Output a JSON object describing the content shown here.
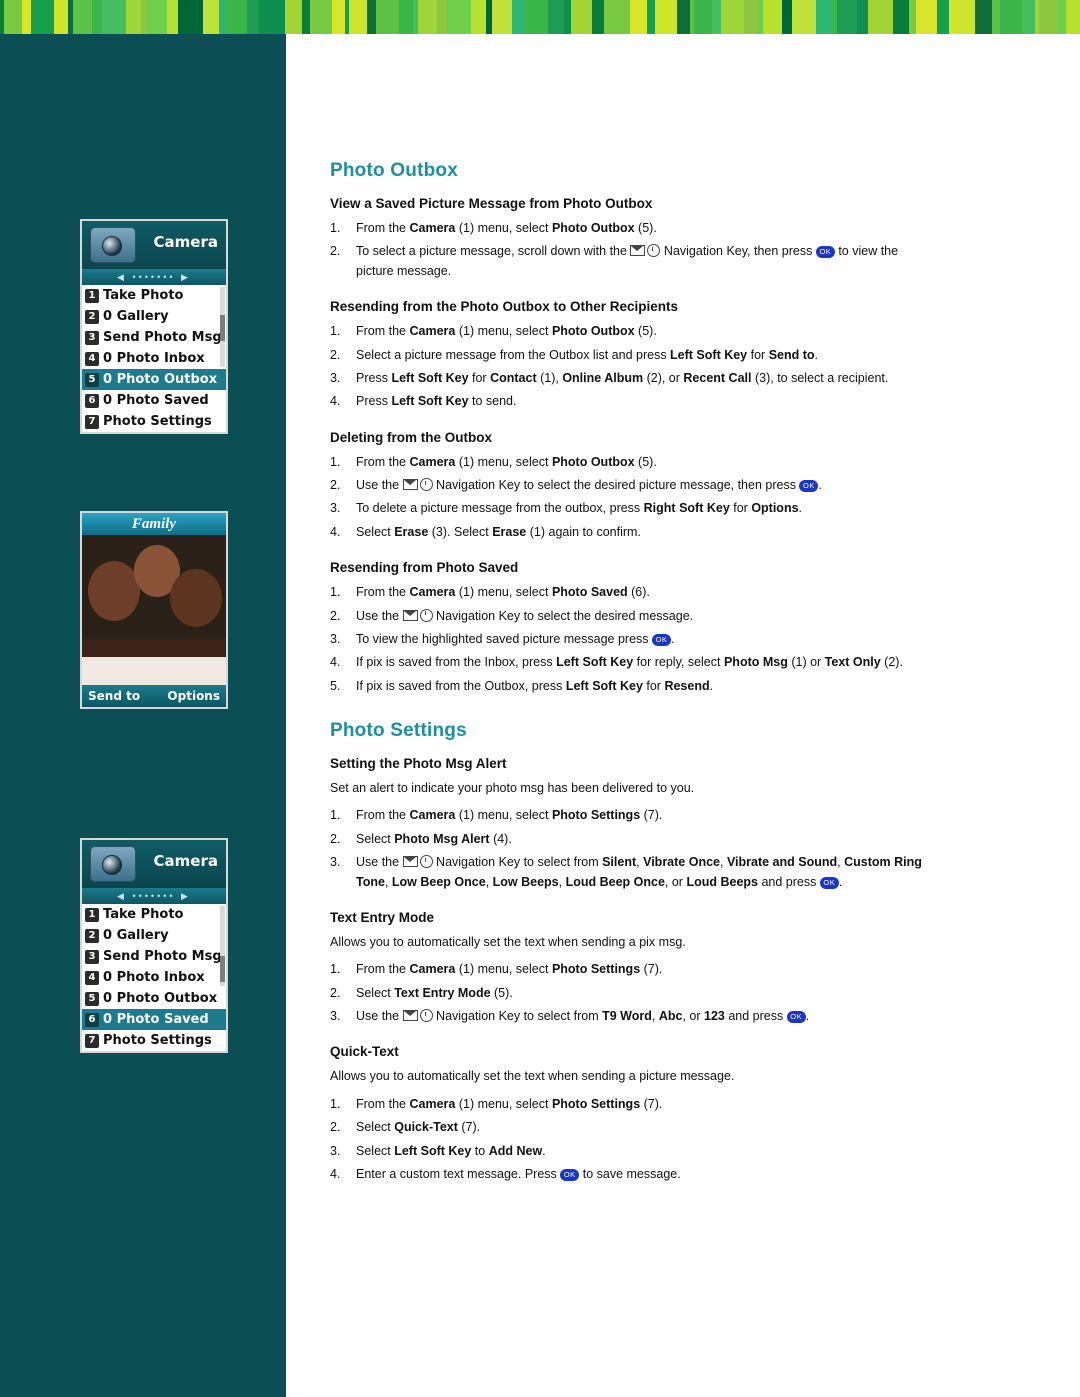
{
  "topbar": {
    "colors": [
      "#0a7d3a",
      "#17a04b",
      "#5cc247",
      "#9ed63a",
      "#b7e02f",
      "#2bb673",
      "#0f8f4d",
      "#7ac943",
      "#cde52a",
      "#3bb54a",
      "#8dc63f",
      "#006837",
      "#39b54a",
      "#a3d435",
      "#d7e62b",
      "#0e6e3a",
      "#46bd5e",
      "#6fcf4a",
      "#bfe23a",
      "#1f9d55"
    ]
  },
  "screens": {
    "menu1": {
      "title": "Camera",
      "items": [
        {
          "num": "1",
          "label": "Take Photo",
          "selected": false
        },
        {
          "num": "2",
          "label": "0 Gallery",
          "selected": false
        },
        {
          "num": "3",
          "label": "Send Photo Msg",
          "selected": false
        },
        {
          "num": "4",
          "label": "0 Photo Inbox",
          "selected": false
        },
        {
          "num": "5",
          "label": "0 Photo Outbox",
          "selected": true
        },
        {
          "num": "6",
          "label": "0 Photo Saved",
          "selected": false
        },
        {
          "num": "7",
          "label": "Photo Settings",
          "selected": false
        }
      ]
    },
    "menu2": {
      "title": "Camera",
      "items": [
        {
          "num": "1",
          "label": "Take Photo",
          "selected": false
        },
        {
          "num": "2",
          "label": "0 Gallery",
          "selected": false
        },
        {
          "num": "3",
          "label": "Send Photo Msg",
          "selected": false
        },
        {
          "num": "4",
          "label": "0 Photo Inbox",
          "selected": false
        },
        {
          "num": "5",
          "label": "0 Photo Outbox",
          "selected": false
        },
        {
          "num": "6",
          "label": "0 Photo Saved",
          "selected": true
        },
        {
          "num": "7",
          "label": "Photo Settings",
          "selected": false
        }
      ]
    },
    "photo": {
      "title": "Family",
      "left_soft_key": "Send to",
      "right_soft_key": "Options"
    }
  },
  "content": {
    "section1": {
      "heading": "Photo Outbox",
      "blocks": [
        {
          "subheading": "View a Saved Picture Message from Photo Outbox",
          "steps": [
            "From the <b>Camera</b> (1) menu, select <b>Photo Outbox</b> (5).",
            "To select a picture message, scroll down with the [NAV] Navigation Key, then press [OK] to view the picture message."
          ]
        },
        {
          "subheading": "Resending from the Photo Outbox to Other Recipients",
          "steps": [
            "From the <b>Camera</b> (1) menu, select <b>Photo Outbox</b> (5).",
            "Select a picture message from the Outbox list and press <b>Left Soft Key</b> for <b>Send to</b>.",
            "Press <b>Left Soft Key</b> for <b>Contact</b> (1), <b>Online Album</b> (2), or <b>Recent Call</b> (3), to select a recipient.",
            "Press <b>Left Soft Key</b> to send."
          ]
        },
        {
          "subheading": "Deleting from the Outbox",
          "steps": [
            "From the <b>Camera</b> (1) menu, select <b>Photo Outbox</b> (5).",
            "Use the [NAV] Navigation Key to select the desired picture message, then press [OK].",
            "To delete a picture message from the outbox, press <b>Right Soft Key</b> for <b>Options</b>.",
            "Select <b>Erase</b> (3). Select <b>Erase</b> (1) again to confirm."
          ]
        },
        {
          "subheading": "Resending from Photo Saved",
          "steps": [
            "From the <b>Camera</b> (1) menu, select <b>Photo Saved</b> (6).",
            "Use the [NAV] Navigation Key to select the desired message.",
            "To view the highlighted saved picture message press [OK].",
            "If pix is saved from the Inbox, press <b>Left Soft Key</b> for reply, select <b>Photo Msg</b> (1) or <b>Text Only</b> (2).",
            "If pix is saved from the Outbox, press <b>Left Soft Key</b> for <b>Resend</b>."
          ]
        }
      ]
    },
    "section2": {
      "heading": "Photo Settings",
      "blocks": [
        {
          "subheading": "Setting the Photo Msg Alert",
          "note": "Set an alert to indicate your photo msg has been delivered to you.",
          "steps": [
            "From the <b>Camera</b> (1) menu, select <b>Photo Settings</b> (7).",
            "Select <b>Photo Msg Alert</b> (4).",
            "Use the [NAV] Navigation Key to select from <b>Silent</b>, <b>Vibrate Once</b>, <b>Vibrate and Sound</b>, <b>Custom Ring Tone</b>, <b>Low Beep Once</b>, <b>Low Beeps</b>, <b>Loud Beep Once</b>, or <b>Loud Beeps</b> and press [OK]."
          ]
        },
        {
          "subheading": "Text Entry Mode",
          "note": "Allows you to automatically set the text when sending a pix msg.",
          "steps": [
            "From the <b>Camera</b> (1) menu, select <b>Photo Settings</b> (7).",
            "Select <b>Text Entry Mode</b> (5).",
            "Use the [NAV] Navigation Key to select from <b>T9 Word</b>, <b>Abc</b>, or <b>123</b> and press [OK]."
          ]
        },
        {
          "subheading": "Quick-Text",
          "note": "Allows you to automatically set the text when sending a picture message.",
          "steps": [
            "From the <b>Camera</b> (1) menu, select <b>Photo Settings</b> (7).",
            "Select <b>Quick-Text</b> (7).",
            "Select <b>Left Soft Key</b> to <b>Add New</b>.",
            "Enter a custom text message.  Press [OK] to save message."
          ]
        }
      ]
    }
  }
}
